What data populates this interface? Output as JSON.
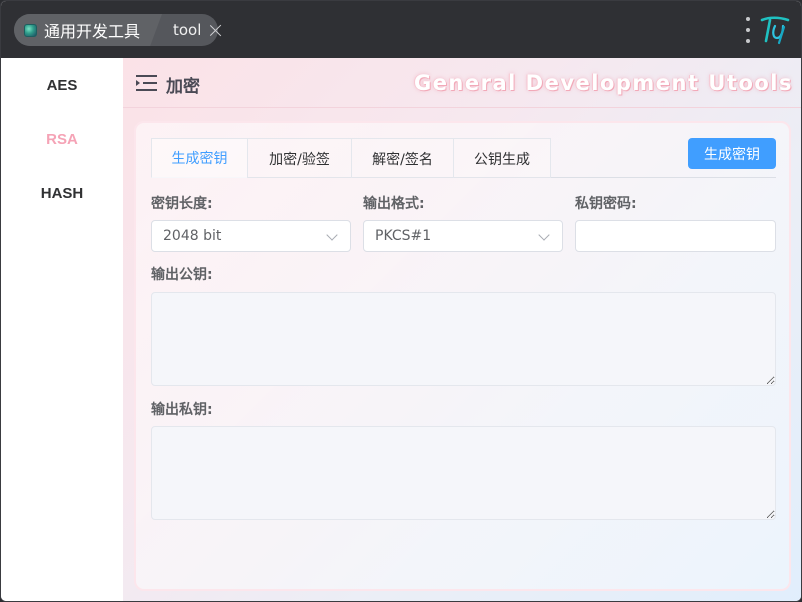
{
  "titlebar": {
    "app_title": "通用开发工具",
    "tab_label": "tool"
  },
  "sidebar": {
    "items": [
      {
        "label": "AES",
        "active": false
      },
      {
        "label": "RSA",
        "active": true
      },
      {
        "label": "HASH",
        "active": false
      }
    ]
  },
  "header": {
    "title": "加密",
    "banner": "General Development Utools"
  },
  "tabs": [
    {
      "label": "生成密钥",
      "active": true
    },
    {
      "label": "加密/验签",
      "active": false
    },
    {
      "label": "解密/签名",
      "active": false
    },
    {
      "label": "公钥生成",
      "active": false
    }
  ],
  "actions": {
    "generate_label": "生成密钥"
  },
  "form": {
    "key_length_label": "密钥长度:",
    "key_length_value": "2048 bit",
    "output_format_label": "输出格式:",
    "output_format_value": "PKCS#1",
    "private_password_label": "私钥密码:",
    "private_password_value": "",
    "public_key_label": "输出公钥:",
    "public_key_value": "",
    "private_key_label": "输出私钥:",
    "private_key_value": ""
  },
  "colors": {
    "accent": "#409eff",
    "active_sidebar": "#f5a3b6",
    "titlebar_bg": "#2f3034"
  }
}
